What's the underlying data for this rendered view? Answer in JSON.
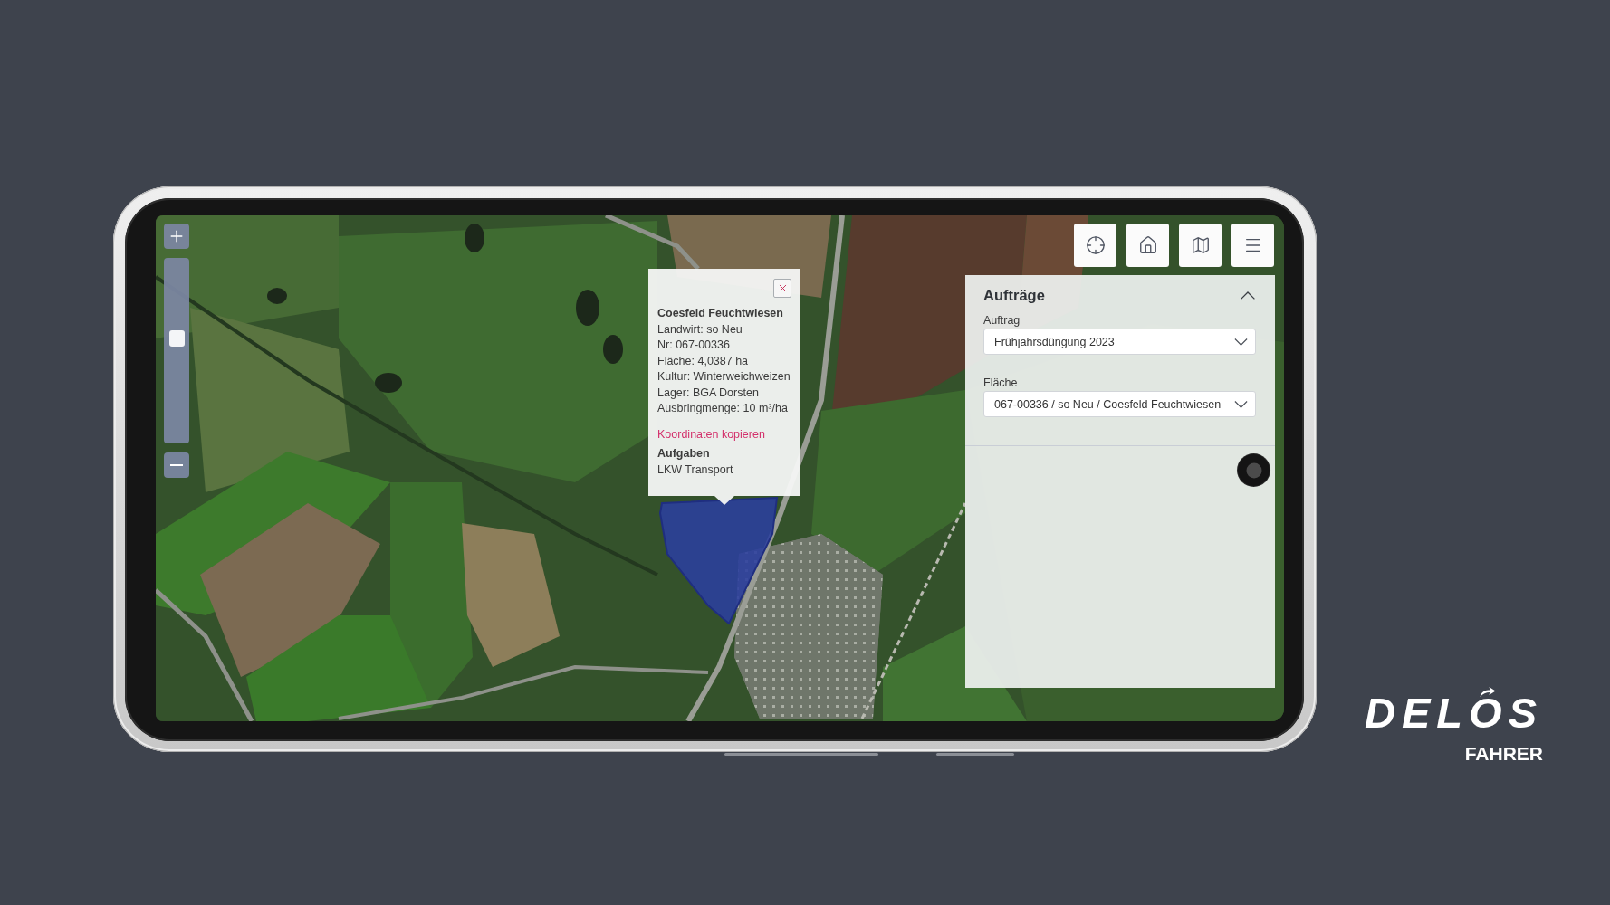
{
  "map": {
    "zoom": {
      "level": 0.57
    }
  },
  "popup": {
    "title": "Coesfeld Feuchtwiesen",
    "lines": [
      "Landwirt: so Neu",
      "Nr: 067-00336",
      "Fläche: 4,0387 ha",
      "Kultur: Winterweichweizen",
      "Lager: BGA Dorsten",
      "Ausbringmenge: 10 m³/ha"
    ],
    "link": "Koordinaten kopieren",
    "section_title": "Aufgaben",
    "section_items": [
      "LKW Transport"
    ]
  },
  "panel": {
    "title": "Aufträge",
    "expanded": true,
    "fields": [
      {
        "label": "Auftrag",
        "value": "Frühjahrsdüngung 2023"
      },
      {
        "label": "Fläche",
        "value": "067-00336 / so Neu / Coesfeld Feuchtwiesen"
      }
    ]
  },
  "brand": {
    "logo": "DELOS",
    "subtitle": "FAHRER"
  }
}
